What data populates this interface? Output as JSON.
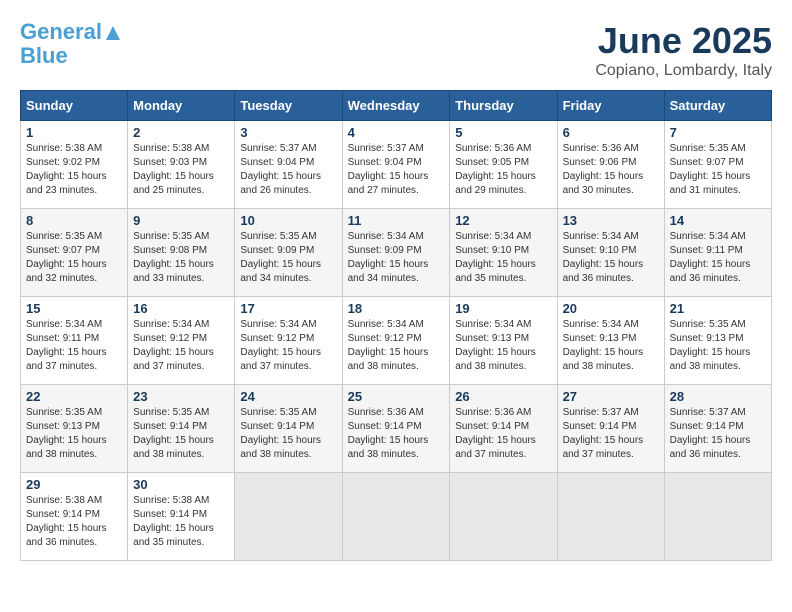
{
  "logo": {
    "line1a": "General",
    "line1b": "Blue",
    "tagline": ""
  },
  "title": "June 2025",
  "subtitle": "Copiano, Lombardy, Italy",
  "weekdays": [
    "Sunday",
    "Monday",
    "Tuesday",
    "Wednesday",
    "Thursday",
    "Friday",
    "Saturday"
  ],
  "weeks": [
    [
      {
        "day": "1",
        "info": "Sunrise: 5:38 AM\nSunset: 9:02 PM\nDaylight: 15 hours\nand 23 minutes."
      },
      {
        "day": "2",
        "info": "Sunrise: 5:38 AM\nSunset: 9:03 PM\nDaylight: 15 hours\nand 25 minutes."
      },
      {
        "day": "3",
        "info": "Sunrise: 5:37 AM\nSunset: 9:04 PM\nDaylight: 15 hours\nand 26 minutes."
      },
      {
        "day": "4",
        "info": "Sunrise: 5:37 AM\nSunset: 9:04 PM\nDaylight: 15 hours\nand 27 minutes."
      },
      {
        "day": "5",
        "info": "Sunrise: 5:36 AM\nSunset: 9:05 PM\nDaylight: 15 hours\nand 29 minutes."
      },
      {
        "day": "6",
        "info": "Sunrise: 5:36 AM\nSunset: 9:06 PM\nDaylight: 15 hours\nand 30 minutes."
      },
      {
        "day": "7",
        "info": "Sunrise: 5:35 AM\nSunset: 9:07 PM\nDaylight: 15 hours\nand 31 minutes."
      }
    ],
    [
      {
        "day": "8",
        "info": "Sunrise: 5:35 AM\nSunset: 9:07 PM\nDaylight: 15 hours\nand 32 minutes."
      },
      {
        "day": "9",
        "info": "Sunrise: 5:35 AM\nSunset: 9:08 PM\nDaylight: 15 hours\nand 33 minutes."
      },
      {
        "day": "10",
        "info": "Sunrise: 5:35 AM\nSunset: 9:09 PM\nDaylight: 15 hours\nand 34 minutes."
      },
      {
        "day": "11",
        "info": "Sunrise: 5:34 AM\nSunset: 9:09 PM\nDaylight: 15 hours\nand 34 minutes."
      },
      {
        "day": "12",
        "info": "Sunrise: 5:34 AM\nSunset: 9:10 PM\nDaylight: 15 hours\nand 35 minutes."
      },
      {
        "day": "13",
        "info": "Sunrise: 5:34 AM\nSunset: 9:10 PM\nDaylight: 15 hours\nand 36 minutes."
      },
      {
        "day": "14",
        "info": "Sunrise: 5:34 AM\nSunset: 9:11 PM\nDaylight: 15 hours\nand 36 minutes."
      }
    ],
    [
      {
        "day": "15",
        "info": "Sunrise: 5:34 AM\nSunset: 9:11 PM\nDaylight: 15 hours\nand 37 minutes."
      },
      {
        "day": "16",
        "info": "Sunrise: 5:34 AM\nSunset: 9:12 PM\nDaylight: 15 hours\nand 37 minutes."
      },
      {
        "day": "17",
        "info": "Sunrise: 5:34 AM\nSunset: 9:12 PM\nDaylight: 15 hours\nand 37 minutes."
      },
      {
        "day": "18",
        "info": "Sunrise: 5:34 AM\nSunset: 9:12 PM\nDaylight: 15 hours\nand 38 minutes."
      },
      {
        "day": "19",
        "info": "Sunrise: 5:34 AM\nSunset: 9:13 PM\nDaylight: 15 hours\nand 38 minutes."
      },
      {
        "day": "20",
        "info": "Sunrise: 5:34 AM\nSunset: 9:13 PM\nDaylight: 15 hours\nand 38 minutes."
      },
      {
        "day": "21",
        "info": "Sunrise: 5:35 AM\nSunset: 9:13 PM\nDaylight: 15 hours\nand 38 minutes."
      }
    ],
    [
      {
        "day": "22",
        "info": "Sunrise: 5:35 AM\nSunset: 9:13 PM\nDaylight: 15 hours\nand 38 minutes."
      },
      {
        "day": "23",
        "info": "Sunrise: 5:35 AM\nSunset: 9:14 PM\nDaylight: 15 hours\nand 38 minutes."
      },
      {
        "day": "24",
        "info": "Sunrise: 5:35 AM\nSunset: 9:14 PM\nDaylight: 15 hours\nand 38 minutes."
      },
      {
        "day": "25",
        "info": "Sunrise: 5:36 AM\nSunset: 9:14 PM\nDaylight: 15 hours\nand 38 minutes."
      },
      {
        "day": "26",
        "info": "Sunrise: 5:36 AM\nSunset: 9:14 PM\nDaylight: 15 hours\nand 37 minutes."
      },
      {
        "day": "27",
        "info": "Sunrise: 5:37 AM\nSunset: 9:14 PM\nDaylight: 15 hours\nand 37 minutes."
      },
      {
        "day": "28",
        "info": "Sunrise: 5:37 AM\nSunset: 9:14 PM\nDaylight: 15 hours\nand 36 minutes."
      }
    ],
    [
      {
        "day": "29",
        "info": "Sunrise: 5:38 AM\nSunset: 9:14 PM\nDaylight: 15 hours\nand 36 minutes."
      },
      {
        "day": "30",
        "info": "Sunrise: 5:38 AM\nSunset: 9:14 PM\nDaylight: 15 hours\nand 35 minutes."
      },
      {
        "day": "",
        "info": ""
      },
      {
        "day": "",
        "info": ""
      },
      {
        "day": "",
        "info": ""
      },
      {
        "day": "",
        "info": ""
      },
      {
        "day": "",
        "info": ""
      }
    ]
  ]
}
